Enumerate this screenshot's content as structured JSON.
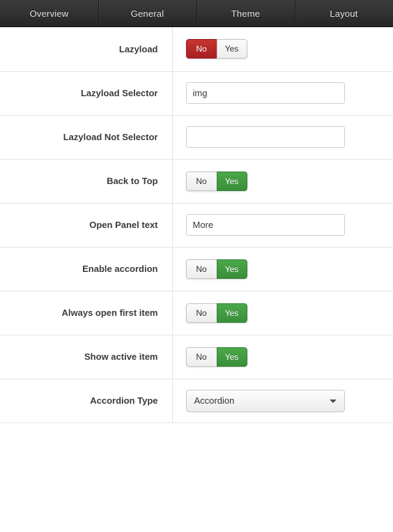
{
  "tabs": [
    {
      "label": "Overview",
      "active": false
    },
    {
      "label": "General",
      "active": false
    },
    {
      "label": "Theme",
      "active": false
    },
    {
      "label": "Layout",
      "active": false
    }
  ],
  "toggle_labels": {
    "no": "No",
    "yes": "Yes"
  },
  "select_arrow_icon": "chevron-down-icon",
  "colors": {
    "active_no_red": "#a91f24",
    "active_yes_green": "#3a8f3a",
    "inactive_gray": "#ededed",
    "tabbar_dark": "#2b2b2b",
    "label_text": "#3b3b3b",
    "row_divider": "#e4e4e4"
  },
  "rows": [
    {
      "label": "Lazyload",
      "type": "toggle",
      "value": "No"
    },
    {
      "label": "Lazyload Selector",
      "type": "text",
      "value": "img",
      "placeholder": ""
    },
    {
      "label": "Lazyload Not Selector",
      "type": "text",
      "value": "",
      "placeholder": ""
    },
    {
      "label": "Back to Top",
      "type": "toggle",
      "value": "Yes"
    },
    {
      "label": "Open Panel text",
      "type": "text",
      "value": "More",
      "placeholder": ""
    },
    {
      "label": "Enable accordion",
      "type": "toggle",
      "value": "Yes"
    },
    {
      "label": "Always open first item",
      "type": "toggle",
      "value": "Yes"
    },
    {
      "label": "Show active item",
      "type": "toggle",
      "value": "Yes"
    },
    {
      "label": "Accordion Type",
      "type": "select",
      "value": "Accordion",
      "options": [
        "Accordion"
      ]
    }
  ]
}
